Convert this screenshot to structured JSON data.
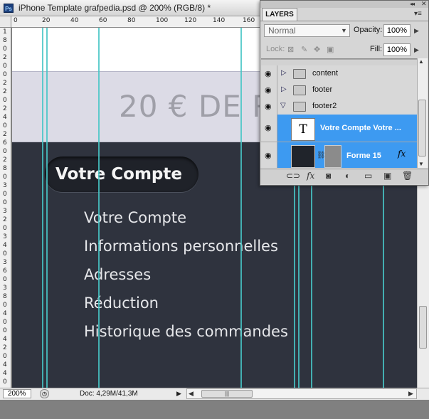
{
  "window": {
    "badge": "Ps",
    "title": "iPhone Template grafpedia.psd @ 200% (RGB/8) *"
  },
  "rulers": {
    "horizontal_ticks": [
      "0",
      "20",
      "40",
      "60",
      "80",
      "100",
      "120",
      "140",
      "160"
    ],
    "vertical_ticks": [
      "1",
      "8",
      "0",
      "2",
      "0",
      "0",
      "2",
      "2",
      "0",
      "2",
      "4",
      "0",
      "2",
      "6",
      "0",
      "2",
      "8",
      "0",
      "3",
      "0",
      "0",
      "3",
      "2",
      "0",
      "3",
      "4",
      "0",
      "3",
      "6",
      "0",
      "3",
      "8",
      "0",
      "4",
      "0",
      "0",
      "4",
      "2",
      "0",
      "4",
      "4",
      "0"
    ]
  },
  "canvas": {
    "promo_text": "20 € DE R",
    "account_button": "Votre Compte",
    "menu": [
      "Votre Compte",
      "Informations personnelles",
      "Adresses",
      "Réduction",
      "Historique des commandes"
    ]
  },
  "status": {
    "zoom": "200%",
    "doc_size": "Doc: 4,29M/41,3M",
    "nav_arrow": "▶",
    "scroll_left": "◀",
    "scroll_right": "▶",
    "scroll_grip": "|||"
  },
  "layers_panel": {
    "tab": "LAYERS",
    "collapse_glyph": "◂◂",
    "close_glyph": "✕",
    "menu_glyph": "▾≡",
    "blend_mode": "Normal",
    "opacity_label": "Opacity:",
    "opacity": "100%",
    "lock_label": "Lock:",
    "fill_label": "Fill:",
    "fill": "100%",
    "layers": [
      {
        "name": "content",
        "type": "group",
        "expanded": false
      },
      {
        "name": "footer",
        "type": "group",
        "expanded": false
      },
      {
        "name": "footer2",
        "type": "group",
        "expanded": true
      },
      {
        "name": "Votre Compte Votre ...",
        "type": "text",
        "selected": true,
        "thumb": "T"
      },
      {
        "name": "Forme 15",
        "type": "shape",
        "selected": true,
        "fx": "fx"
      }
    ],
    "accent_color": "#3d9af1"
  }
}
